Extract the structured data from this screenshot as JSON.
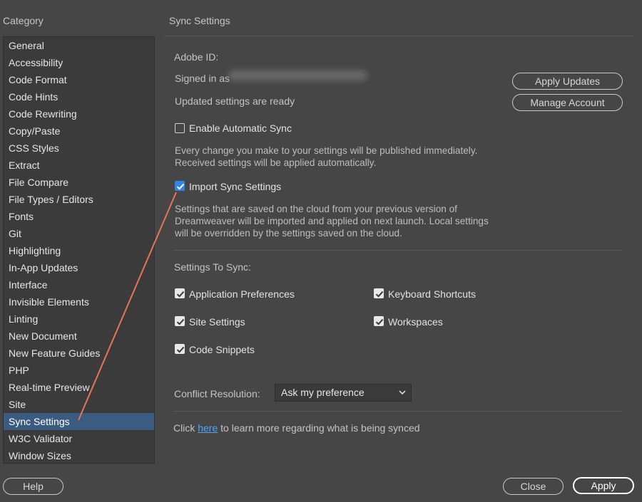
{
  "left": {
    "title": "Category",
    "items": [
      "General",
      "Accessibility",
      "Code Format",
      "Code Hints",
      "Code Rewriting",
      "Copy/Paste",
      "CSS Styles",
      "Extract",
      "File Compare",
      "File Types / Editors",
      "Fonts",
      "Git",
      "Highlighting",
      "In-App Updates",
      "Interface",
      "Invisible Elements",
      "Linting",
      "New Document",
      "New Feature Guides",
      "PHP",
      "Real-time Preview",
      "Site",
      "Sync Settings",
      "W3C Validator",
      "Window Sizes"
    ],
    "selected": "Sync Settings"
  },
  "panel": {
    "title": "Sync Settings",
    "adobe_id_label": "Adobe ID:",
    "signed_in_label": "Signed in as",
    "updated_status": "Updated settings are ready",
    "apply_updates": "Apply Updates",
    "manage_account": "Manage Account",
    "enable_auto_sync": {
      "label": "Enable Automatic Sync",
      "checked": false,
      "desc1": "Every change you make to your settings will be published immediately.",
      "desc2": "Received settings will be applied automatically."
    },
    "import_sync": {
      "label": "Import Sync Settings",
      "checked": true,
      "desc1": "Settings that are saved on the cloud from your previous version of",
      "desc2": "Dreamweaver will be imported and applied on next launch. Local settings",
      "desc3": "will be overridden by the settings saved on the cloud."
    },
    "settings_to_sync_label": "Settings To Sync:",
    "sync_options": {
      "app_prefs": "Application Preferences",
      "keyboard": "Keyboard Shortcuts",
      "site": "Site Settings",
      "workspaces": "Workspaces",
      "snippets": "Code Snippets"
    },
    "conflict_label": "Conflict Resolution:",
    "conflict_value": "Ask my preference",
    "footer_click": "Click",
    "footer_link": "here",
    "footer_rest": "to learn more regarding what is being synced"
  },
  "buttons": {
    "help": "Help",
    "close": "Close",
    "apply": "Apply"
  },
  "colors": {
    "background": "#464646",
    "list_background": "#3b3b3b",
    "selected_row": "#3c5b80",
    "checkbox_blue": "#2f86e6",
    "link": "#4aa6ff",
    "annotation_arrow": "#e8735a"
  }
}
